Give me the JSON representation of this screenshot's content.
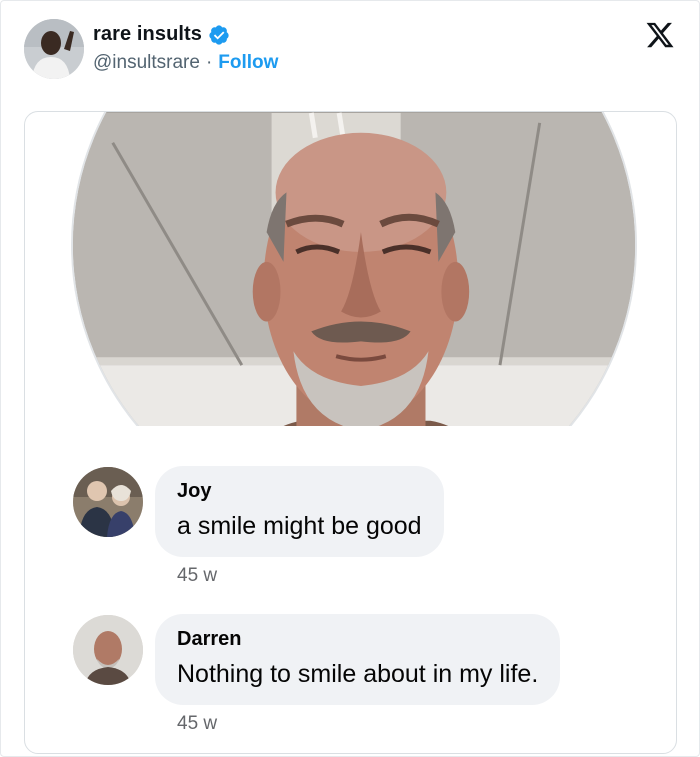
{
  "post": {
    "display_name": "rare insults",
    "handle": "@insultsrare",
    "separator": "·",
    "follow_label": "Follow"
  },
  "comments": [
    {
      "name": "Joy",
      "text": "a smile might be good",
      "time": "45 w"
    },
    {
      "name": "Darren",
      "text": "Nothing to smile about in my life.",
      "time": "45 w"
    }
  ],
  "colors": {
    "follow": "#1d9bf0",
    "verified": "#1d9bf0",
    "bubble": "#f0f2f5"
  },
  "icons": [
    "verified-badge-icon",
    "x-logo-icon"
  ]
}
